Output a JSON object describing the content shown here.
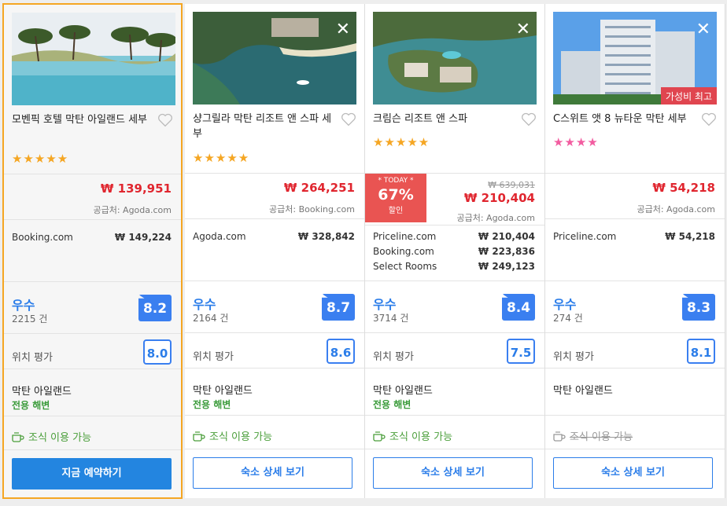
{
  "hotels": [
    {
      "name": "모벤픽 호텔 막탄 아일랜드 세부",
      "stars": "★★★★★",
      "price": "₩ 139,951",
      "supplier": "공급처: Agoda.com",
      "offers": [
        {
          "provider": "Booking.com",
          "price": "₩ 149,224"
        }
      ],
      "rating_word": "우수",
      "review_count": "2215 건",
      "score": "8.2",
      "location_label": "위치 평가",
      "location_score": "8.0",
      "area": "막탄 아일랜드",
      "beach": "전용 해변",
      "breakfast": "조식 이용 가능",
      "button": "지금 예약하기"
    },
    {
      "name": "샹그릴라 막탄 리조트 앤 스파 세부",
      "stars": "★★★★★",
      "price": "₩ 264,251",
      "supplier": "공급처: Booking.com",
      "offers": [
        {
          "provider": "Agoda.com",
          "price": "₩ 328,842"
        }
      ],
      "rating_word": "우수",
      "review_count": "2164 건",
      "score": "8.7",
      "location_label": "위치 평가",
      "location_score": "8.6",
      "area": "막탄 아일랜드",
      "beach": "전용 해변",
      "breakfast": "조식 이용 가능",
      "button": "숙소 상세 보기"
    },
    {
      "name": "크림슨 리조트 앤 스파",
      "stars": "★★★★★",
      "today_label": "* TODAY *",
      "discount": "67%",
      "discount_label": "할인",
      "original_price": "₩ 639,031",
      "price": "₩ 210,404",
      "supplier": "공급처: Agoda.com",
      "offers": [
        {
          "provider": "Priceline.com",
          "price": "₩ 210,404"
        },
        {
          "provider": "Booking.com",
          "price": "₩ 223,836"
        },
        {
          "provider": "Select Rooms",
          "price": "₩ 249,123"
        }
      ],
      "rating_word": "우수",
      "review_count": "3714 건",
      "score": "8.4",
      "location_label": "위치 평가",
      "location_score": "7.5",
      "area": "막탄 아일랜드",
      "beach": "전용 해변",
      "breakfast": "조식 이용 가능",
      "button": "숙소 상세 보기"
    },
    {
      "name": "C스위트 앳 8 뉴타운 막탄 세부",
      "stars": "★★★★",
      "badge": "가성비 최고",
      "price": "₩ 54,218",
      "supplier": "공급처: Agoda.com",
      "offers": [
        {
          "provider": "Priceline.com",
          "price": "₩ 54,218"
        }
      ],
      "rating_word": "우수",
      "review_count": "274 건",
      "score": "8.3",
      "location_label": "위치 평가",
      "location_score": "8.1",
      "area": "막탄 아일랜드",
      "beach": "",
      "breakfast": "조식 이용 가능",
      "button": "숙소 상세 보기"
    }
  ],
  "icons": {
    "close": "close-icon",
    "favorite": "heart-icon",
    "breakfast": "coffee-cup-icon"
  },
  "colors": {
    "price": "#e0262f",
    "accent": "#2b7de9",
    "selected_border": "#f5a623",
    "discount": "#e95452",
    "badge": "#e0454f"
  }
}
